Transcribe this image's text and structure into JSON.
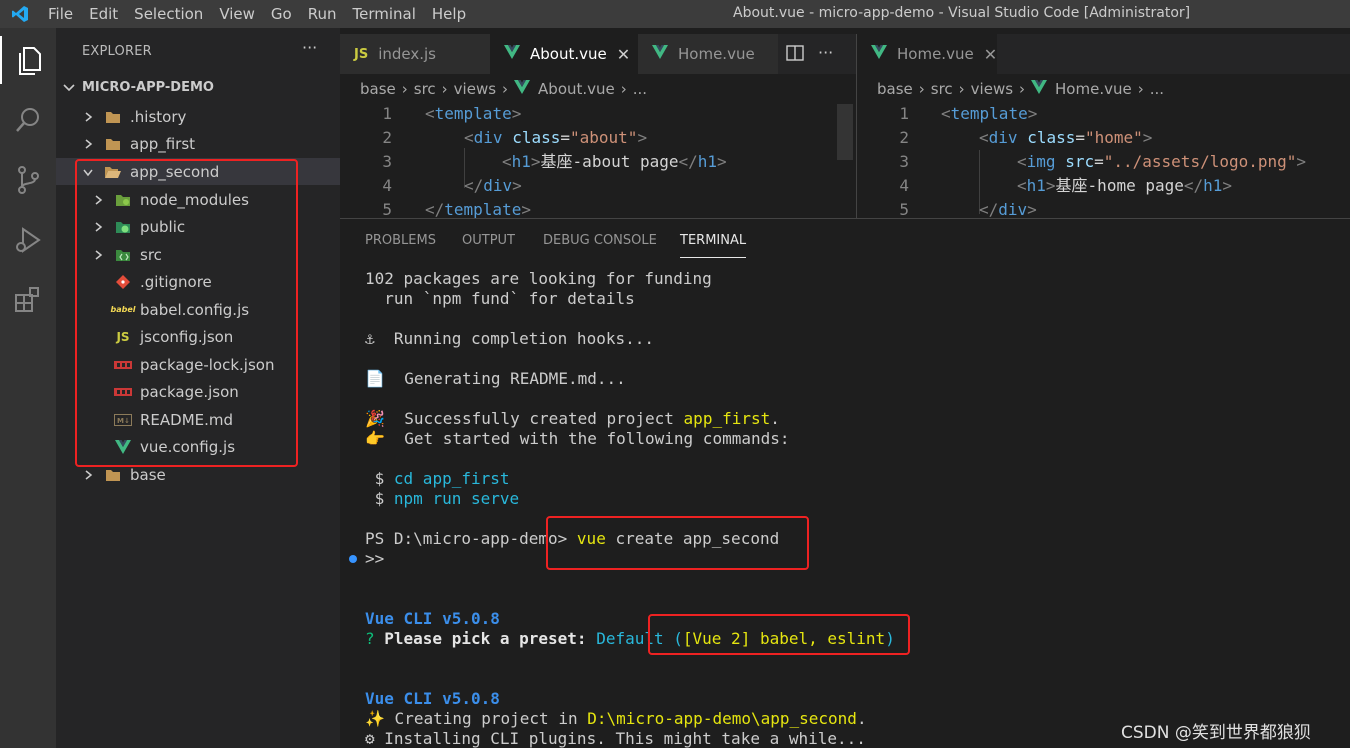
{
  "titlebar": {
    "menu": [
      "File",
      "Edit",
      "Selection",
      "View",
      "Go",
      "Run",
      "Terminal",
      "Help"
    ],
    "title": "About.vue - micro-app-demo - Visual Studio Code [Administrator]"
  },
  "activitybar": {
    "icons": [
      "files-icon",
      "search-icon",
      "source-control-icon",
      "run-debug-icon",
      "extensions-icon"
    ]
  },
  "explorer": {
    "title": "EXPLORER",
    "more": "···",
    "root": "MICRO-APP-DEMO",
    "items": [
      {
        "label": ".history",
        "icon": "folder-icon",
        "chevron": "right"
      },
      {
        "label": "app_first",
        "icon": "folder-icon",
        "chevron": "right"
      },
      {
        "label": "app_second",
        "icon": "folder-open-icon",
        "chevron": "down"
      },
      {
        "label": "node_modules",
        "icon": "node-modules-folder-icon",
        "chevron": "right"
      },
      {
        "label": "public",
        "icon": "public-folder-icon",
        "chevron": "right"
      },
      {
        "label": "src",
        "icon": "src-folder-icon",
        "chevron": "right"
      },
      {
        "label": ".gitignore",
        "icon": "git-icon"
      },
      {
        "label": "babel.config.js",
        "icon": "babel-icon"
      },
      {
        "label": "jsconfig.json",
        "icon": "js-icon"
      },
      {
        "label": "package-lock.json",
        "icon": "npm-icon"
      },
      {
        "label": "package.json",
        "icon": "npm-icon"
      },
      {
        "label": "README.md",
        "icon": "markdown-icon"
      },
      {
        "label": "vue.config.js",
        "icon": "vue-icon"
      },
      {
        "label": "base",
        "icon": "folder-icon",
        "chevron": "right"
      }
    ]
  },
  "editor_left": {
    "tabs": [
      {
        "label": "index.js",
        "icon": "JS"
      },
      {
        "label": "About.vue",
        "close": "✕"
      },
      {
        "label": "Home.vue"
      }
    ],
    "split_icon": "▯▯",
    "more": "···",
    "breadcrumbs": [
      "base",
      "src",
      "views",
      "About.vue",
      "..."
    ],
    "lines": [
      {
        "n": "1",
        "code": "<template>"
      },
      {
        "n": "2",
        "code": "<div class=\"about\">"
      },
      {
        "n": "3",
        "code": "<h1>基座-about page</h1>"
      },
      {
        "n": "4",
        "code": "</div>"
      },
      {
        "n": "5",
        "code": "</template>"
      }
    ]
  },
  "editor_right": {
    "tab": {
      "label": "Home.vue",
      "close": "✕"
    },
    "breadcrumbs": [
      "base",
      "src",
      "views",
      "Home.vue",
      "..."
    ],
    "lines": [
      {
        "n": "1"
      },
      {
        "n": "2"
      },
      {
        "n": "3"
      },
      {
        "n": "4"
      },
      {
        "n": "5"
      }
    ]
  },
  "panel": {
    "tabs": [
      "PROBLEMS",
      "OUTPUT",
      "DEBUG CONSOLE",
      "TERMINAL"
    ],
    "terminal": {
      "l1": "102 packages are looking for funding",
      "l2": "  run `npm fund` for details",
      "l3_icon": "⚓",
      "l3": "Running completion hooks...",
      "l4_icon": "📄",
      "l4": "Generating README.md...",
      "l5_icon": "🎉",
      "l5a": "Successfully created project ",
      "l5b": "app_first",
      "l5c": ".",
      "l6_icon": "👉",
      "l6": "Get started with the following commands:",
      "cmd1_prompt": " $ ",
      "cmd1": "cd app_first",
      "cmd2_prompt": " $ ",
      "cmd2": "npm run serve",
      "ps_prompt": "PS D:\\micro-app-demo> ",
      "ps_cmd_a": "vue",
      "ps_cmd_b": " create app_second",
      "cont": ">>",
      "cli1": "Vue CLI v5.0.8",
      "pick_q": "? ",
      "pick": "Please pick a preset: ",
      "pick_default": "Default",
      "pick_open": " (",
      "pick_opts": "[Vue 2] babel, eslint",
      "pick_close": ")",
      "cli2": "Vue CLI v5.0.8",
      "creating_icon": "✨",
      "creating_a": " Creating project in ",
      "creating_path": "D:\\micro-app-demo\\app_second",
      "creating_end": ".",
      "installing_icon": "⚙",
      "installing": " Installing CLI plugins. This might take a while..."
    }
  },
  "watermark": "CSDN @笑到世界都狼狈",
  "colors": {
    "highlight_box": "#ee2222",
    "accent": "#007acc"
  }
}
